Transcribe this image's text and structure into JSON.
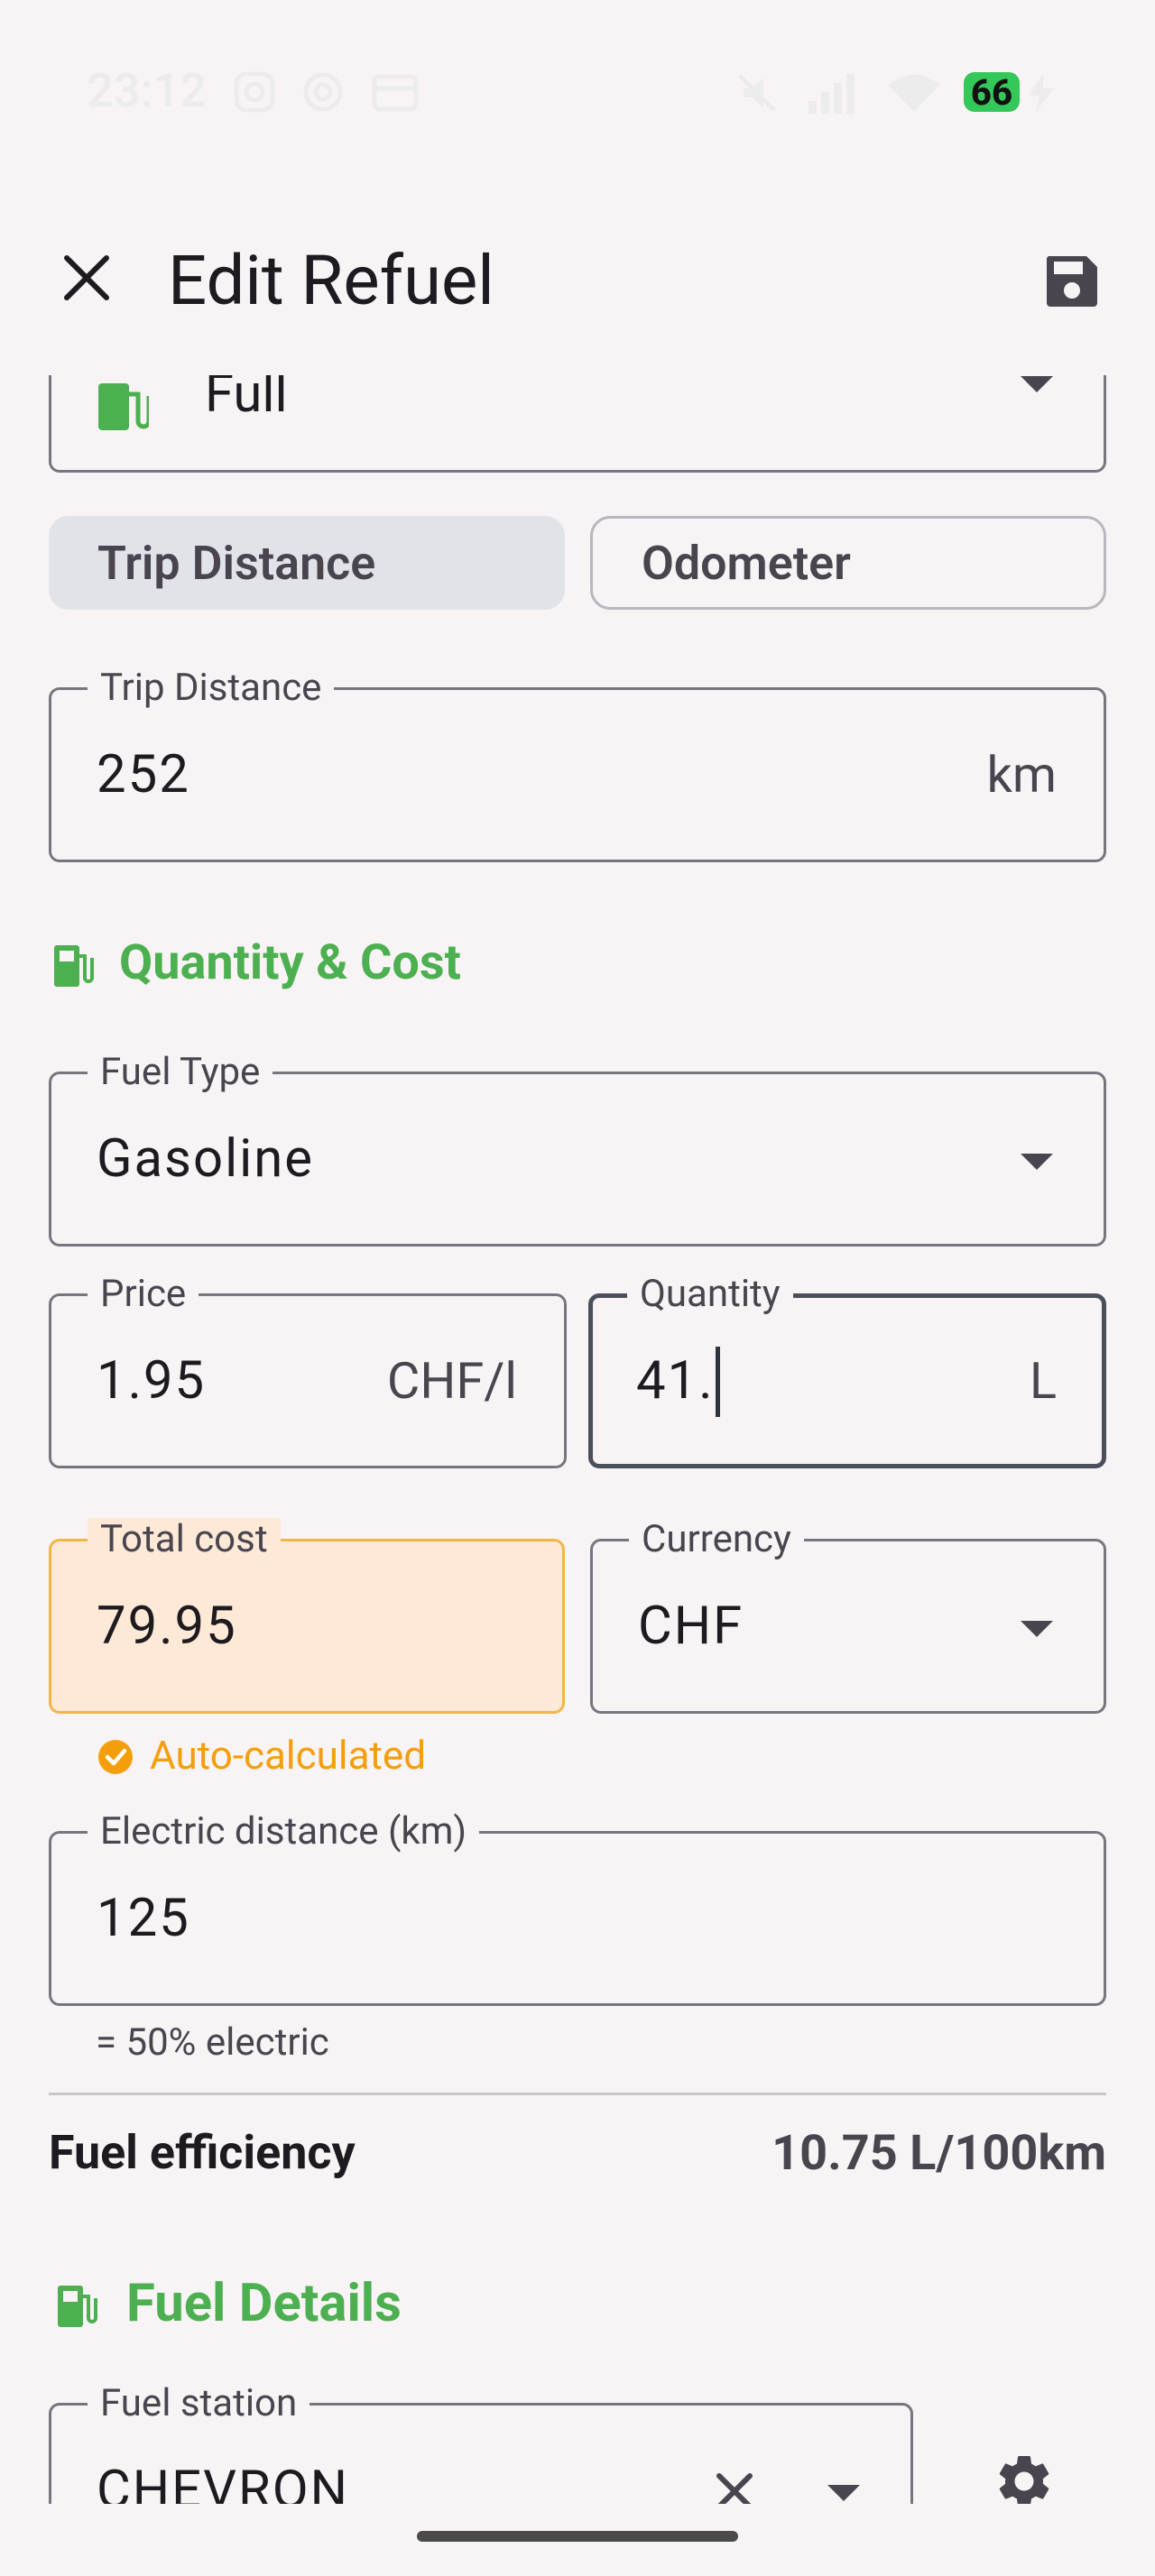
{
  "status_bar": {
    "time": "23:12",
    "battery": "66"
  },
  "top_bar": {
    "title": "Edit Refuel"
  },
  "fill_field": {
    "value": "Full"
  },
  "distance_mode": {
    "options": [
      "Trip Distance",
      "Odometer"
    ],
    "selected": "Trip Distance"
  },
  "trip_distance": {
    "label": "Trip Distance",
    "value": "252",
    "unit": "km"
  },
  "quantity_cost_section": {
    "title": "Quantity & Cost"
  },
  "fuel_type": {
    "label": "Fuel Type",
    "value": "Gasoline"
  },
  "price": {
    "label": "Price",
    "value": "1.95",
    "unit": "CHF/l"
  },
  "quantity": {
    "label": "Quantity",
    "value": "41.",
    "unit": "L"
  },
  "total_cost": {
    "label": "Total cost",
    "value": "79.95",
    "helper": "Auto-calculated"
  },
  "currency": {
    "label": "Currency",
    "value": "CHF"
  },
  "electric_distance": {
    "label": "Electric distance (km)",
    "value": "125",
    "helper": "= 50% electric"
  },
  "fuel_efficiency": {
    "label": "Fuel efficiency",
    "value": "10.75 L/100km"
  },
  "fuel_details_section": {
    "title": "Fuel Details"
  },
  "fuel_station": {
    "label": "Fuel station",
    "value": "CHEVRON"
  },
  "colors": {
    "accent_green": "#4caf50",
    "auto_orange": "#f59e0b",
    "background": "#f8f4f5"
  }
}
